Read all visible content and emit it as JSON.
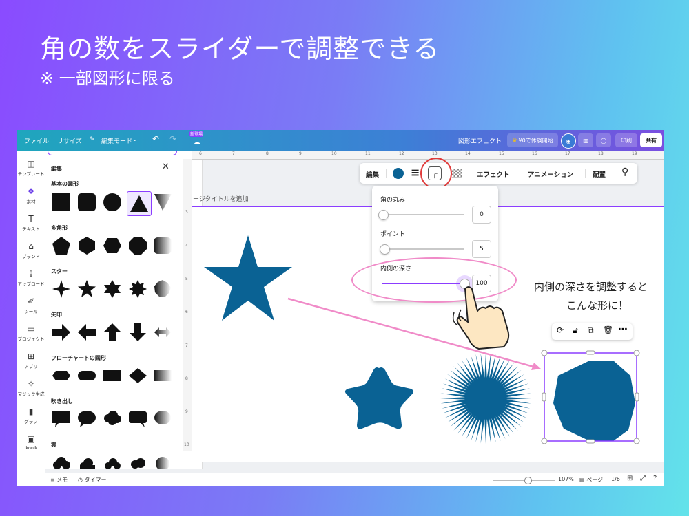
{
  "slide": {
    "title": "角の数をスライダーで調整できる",
    "subtitle": "※ 一部図形に限る",
    "annotation_line1": "内側の深さを調整すると",
    "annotation_line2": "こんな形に！"
  },
  "topbar": {
    "file": "ファイル",
    "resize": "リサイズ",
    "edit_mode": "編集モード",
    "new_badge": "新登場",
    "shape_effect": "図形エフェクト",
    "trial": "¥0で体験開始",
    "print": "印刷",
    "share": "共有"
  },
  "rail": {
    "items": [
      "テンプレート",
      "素材",
      "テキスト",
      "ブランド",
      "アップロード",
      "ツール",
      "プロジェクト",
      "アプリ",
      "マジック生成",
      "グラフ",
      "Ikonik"
    ]
  },
  "panel": {
    "header": "編集",
    "categories": [
      "基本の図形",
      "多角形",
      "スター",
      "矢印",
      "フローチャートの図形",
      "吹き出し",
      "雲"
    ]
  },
  "page_title_placeholder": "ージタイトルを追加",
  "ruler": {
    "top": [
      "6",
      "7",
      "8",
      "9",
      "10",
      "11",
      "12",
      "13",
      "14",
      "15",
      "16",
      "17",
      "18",
      "19"
    ],
    "left": [
      "3",
      "4",
      "5",
      "6",
      "7",
      "8",
      "9",
      "10"
    ]
  },
  "ctx_toolbar": {
    "edit": "編集",
    "effect": "エフェクト",
    "animation": "アニメーション",
    "arrange": "配置",
    "shape_color": "#0a6294"
  },
  "popup": {
    "corner_label": "角の丸み",
    "corner_value": "0",
    "corner_level": 0,
    "points_label": "ポイント",
    "points_value": "5",
    "points_level": 0.02,
    "depth_label": "内側の深さ",
    "depth_value": "100",
    "depth_level": 1
  },
  "bottombar": {
    "memo": "メモ",
    "timer": "タイマー",
    "zoom": "107%",
    "page": "ページ",
    "page_count": "1/6",
    "zoom_level": 0.56
  },
  "colors": {
    "shape": "#0a6294",
    "accent": "#8b3dff",
    "highlight_red": "#e03a3a",
    "highlight_pink": "#f08bc8"
  }
}
